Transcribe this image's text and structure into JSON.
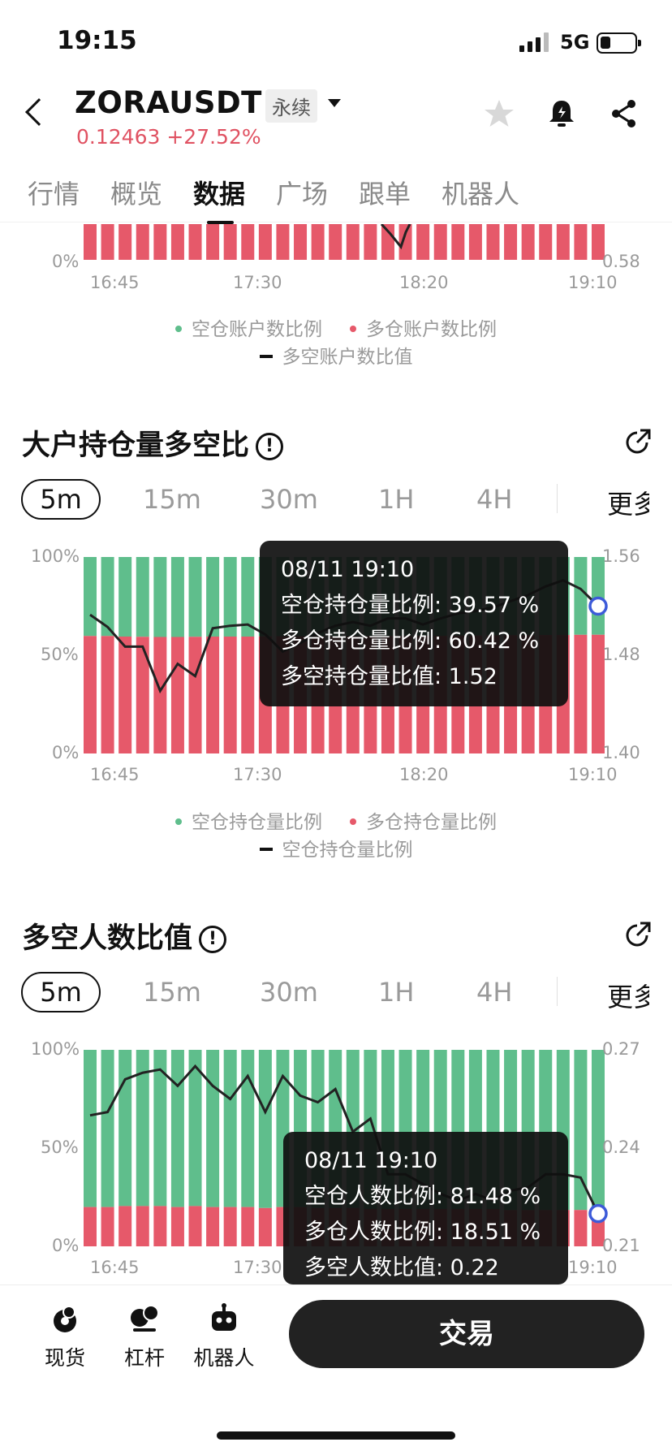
{
  "status_bar": {
    "time": "19:15",
    "network": "5G"
  },
  "header": {
    "symbol": "ZORAUSDT",
    "contract_type": "永续",
    "price": "0.12463",
    "change": "+27.52%"
  },
  "tabs": [
    "行情",
    "概览",
    "数据",
    "广场",
    "跟单",
    "机器人"
  ],
  "active_tab": "数据",
  "colors": {
    "green": "#5fbe8c",
    "red": "#e6596a",
    "line": "#222222",
    "price_red": "#e05262"
  },
  "sections": {
    "account_ratio": {
      "legend_short": "空仓账户数比例",
      "legend_long": "多仓账户数比例",
      "legend_line": "多空账户数比值"
    },
    "position_ratio": {
      "title": "大户持仓量多空比",
      "intervals": [
        "5m",
        "15m",
        "30m",
        "1H",
        "4H"
      ],
      "more": "更多",
      "legend_short": "空仓持仓量比例",
      "legend_long": "多仓持仓量比例",
      "legend_line": "空仓持仓量比例",
      "tooltip": {
        "time": "08/11 19:10",
        "short": "空仓持仓量比例: 39.57 %",
        "long": "多仓持仓量比例: 60.42 %",
        "ratio": "多空持仓量比值: 1.52"
      }
    },
    "people_ratio": {
      "title": "多空人数比值",
      "intervals": [
        "5m",
        "15m",
        "30m",
        "1H",
        "4H"
      ],
      "more": "更多",
      "tooltip": {
        "time": "08/11 19:10",
        "short": "空仓人数比例: 81.48 %",
        "long": "多仓人数比例: 18.51 %",
        "ratio": "多空人数比值: 0.22"
      }
    }
  },
  "bottom_bar": {
    "spot": "现货",
    "margin": "杠杆",
    "bot": "机器人",
    "trade": "交易"
  },
  "chart_data": [
    {
      "type": "bar",
      "title": "",
      "x_tick_labels": [
        "16:45",
        "17:30",
        "18:20",
        "19:10"
      ],
      "y_left_ticks": [
        "0%"
      ],
      "y_right_ticks": [
        "0.58"
      ],
      "series": [
        {
          "name": "多仓账户数比例",
          "values": [
            100,
            100,
            100,
            100,
            100,
            100,
            100,
            100,
            100,
            100,
            100,
            100,
            100,
            100,
            100,
            100,
            100,
            100,
            100,
            100,
            100,
            100,
            100,
            100,
            100,
            100,
            100,
            100,
            100,
            100
          ]
        }
      ],
      "line": {
        "name": "多空账户数比值",
        "values": [
          0.64,
          0.6,
          0.58
        ]
      },
      "legend_position": "bottom"
    },
    {
      "type": "bar",
      "title": "大户持仓量多空比",
      "x_tick_labels": [
        "16:45",
        "17:30",
        "18:20",
        "19:10"
      ],
      "y_left_ticks": [
        "100%",
        "50%",
        "0%"
      ],
      "y_right_ticks": [
        "1.56",
        "1.48",
        "1.40"
      ],
      "ylim_left": [
        0,
        100
      ],
      "ylim_right": [
        1.4,
        1.56
      ],
      "series": [
        {
          "name": "多仓持仓量比例",
          "values": [
            59.8,
            59.8,
            59.5,
            59.4,
            59.3,
            59.3,
            59.4,
            59.5,
            59.5,
            59.5,
            59.6,
            59.7,
            59.7,
            59.6,
            59.6,
            59.7,
            59.8,
            59.8,
            59.8,
            59.9,
            59.9,
            60.0,
            60.0,
            60.1,
            60.2,
            60.2,
            60.3,
            60.3,
            60.4,
            60.42
          ]
        },
        {
          "name": "空仓持仓量比例",
          "values": [
            40.2,
            40.2,
            40.5,
            40.6,
            40.7,
            40.7,
            40.6,
            40.5,
            40.5,
            40.5,
            40.4,
            40.3,
            40.3,
            40.4,
            40.4,
            40.3,
            40.2,
            40.2,
            40.2,
            40.1,
            40.1,
            40.0,
            40.0,
            39.9,
            39.8,
            39.8,
            39.7,
            39.7,
            39.6,
            39.57
          ]
        }
      ],
      "line": {
        "name": "空仓持仓量比例",
        "values": [
          1.513,
          1.503,
          1.487,
          1.487,
          1.451,
          1.473,
          1.463,
          1.502,
          1.504,
          1.505,
          1.497,
          1.483,
          1.49,
          1.498,
          1.504,
          1.507,
          1.504,
          1.51,
          1.51,
          1.505,
          1.51,
          1.514,
          1.516,
          1.519,
          1.524,
          1.529,
          1.536,
          1.541,
          1.534,
          1.52
        ]
      },
      "legend_position": "bottom"
    },
    {
      "type": "bar",
      "title": "多空人数比值",
      "x_tick_labels": [
        "16:45",
        "17:30",
        "",
        "19:10"
      ],
      "y_left_ticks": [
        "100%",
        "50%",
        "0%"
      ],
      "y_right_ticks": [
        "0.27",
        "0.24",
        "0.21"
      ],
      "ylim_left": [
        0,
        100
      ],
      "ylim_right": [
        0.21,
        0.27
      ],
      "series": [
        {
          "name": "多仓人数比例",
          "values": [
            20,
            20,
            20.5,
            20.5,
            20.5,
            20,
            20.5,
            20,
            20,
            20,
            19.5,
            20,
            20,
            19.5,
            19.5,
            19.5,
            19,
            19,
            19,
            19,
            19,
            19,
            19,
            19,
            18.5,
            18.5,
            18.5,
            18.5,
            18.5,
            18.51
          ]
        },
        {
          "name": "空仓人数比例",
          "values": [
            80,
            80,
            79.5,
            79.5,
            79.5,
            80,
            79.5,
            80,
            80,
            80,
            80.5,
            80,
            80,
            80.5,
            80.5,
            80.5,
            81,
            81,
            81,
            81,
            81,
            81,
            81,
            81,
            81.5,
            81.5,
            81.5,
            81.5,
            81.5,
            81.48
          ]
        }
      ],
      "line": {
        "name": "多空人数比值",
        "values": [
          0.25,
          0.251,
          0.261,
          0.263,
          0.264,
          0.259,
          0.265,
          0.259,
          0.255,
          0.262,
          0.251,
          0.262,
          0.256,
          0.254,
          0.258,
          0.245,
          0.249,
          0.232,
          0.232,
          0.229,
          0.226,
          0.224,
          0.226,
          0.224,
          0.227,
          0.228,
          0.232,
          0.232,
          0.231,
          0.22
        ]
      }
    }
  ]
}
